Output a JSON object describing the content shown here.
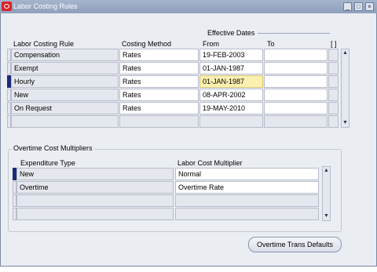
{
  "window": {
    "title": "Labor Costing Rules",
    "controls": [
      "_",
      "□",
      "×"
    ]
  },
  "header": {
    "effective_dates": "Effective Dates",
    "col_rule": "Labor Costing Rule",
    "col_method": "Costing Method",
    "col_from": "From",
    "col_to": "To",
    "col_flex": "[ ]"
  },
  "rules": [
    {
      "rule": "Compensation",
      "method": "Rates",
      "from": "19-FEB-2003",
      "to": ""
    },
    {
      "rule": "Exempt",
      "method": "Rates",
      "from": "01-JAN-1987",
      "to": ""
    },
    {
      "rule": "Hourly",
      "method": "Rates",
      "from": "01-JAN-1987",
      "to": ""
    },
    {
      "rule": "New",
      "method": "Rates",
      "from": "08-APR-2002",
      "to": ""
    },
    {
      "rule": "On Request",
      "method": "Rates",
      "from": "19-MAY-2010",
      "to": ""
    }
  ],
  "overtime": {
    "group_title": "Overtime Cost Multipliers",
    "col_expenditure": "Expenditure Type",
    "col_multiplier": "Labor Cost Multiplier",
    "rows": [
      {
        "type": "New",
        "multiplier": "Normal"
      },
      {
        "type": "Overtime",
        "multiplier": "Overtime Rate"
      }
    ]
  },
  "buttons": {
    "defaults": "Overtime Trans Defaults"
  },
  "icons": [
    "oracle-logo-icon",
    "minimize-icon",
    "maximize-icon",
    "close-icon",
    "scroll-up-icon",
    "scroll-down-icon"
  ]
}
